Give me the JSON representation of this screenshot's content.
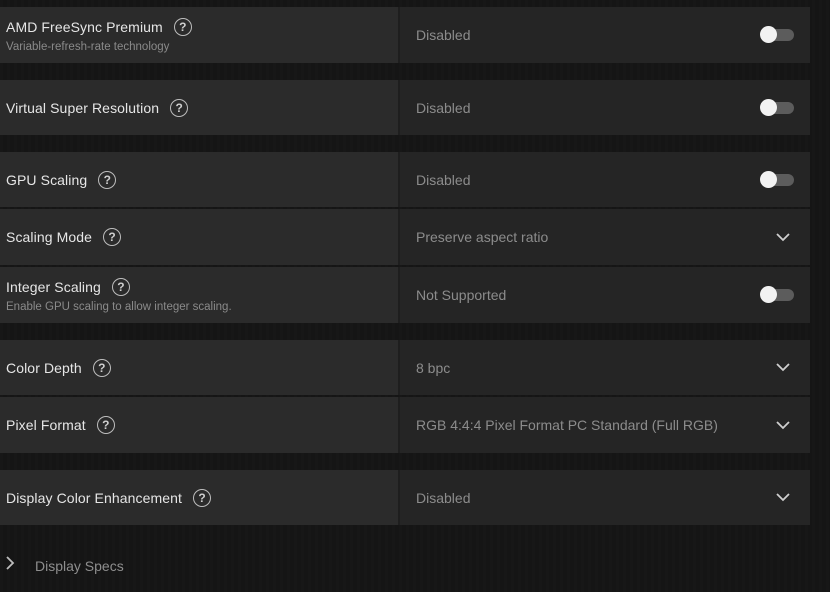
{
  "settings": [
    {
      "label": "AMD FreeSync Premium",
      "subtext": "Variable-refresh-rate technology",
      "value": "Disabled",
      "control": "toggle",
      "enabled": false
    },
    {
      "label": "Virtual Super Resolution",
      "subtext": "",
      "value": "Disabled",
      "control": "toggle",
      "enabled": false
    },
    {
      "label": "GPU Scaling",
      "subtext": "",
      "value": "Disabled",
      "control": "toggle",
      "enabled": false
    },
    {
      "label": "Scaling Mode",
      "subtext": "",
      "value": "Preserve aspect ratio",
      "control": "dropdown"
    },
    {
      "label": "Integer Scaling",
      "subtext": "Enable GPU scaling to allow integer scaling.",
      "value": "Not Supported",
      "control": "toggle",
      "enabled": false
    },
    {
      "label": "Color Depth",
      "subtext": "",
      "value": "8 bpc",
      "control": "dropdown"
    },
    {
      "label": "Pixel Format",
      "subtext": "",
      "value": "RGB 4:4:4 Pixel Format PC Standard (Full RGB)",
      "control": "dropdown"
    },
    {
      "label": "Display Color Enhancement",
      "subtext": "",
      "value": "Disabled",
      "control": "dropdown"
    }
  ],
  "footer": {
    "label": "Display Specs"
  },
  "icons": {
    "help": "help-circle-icon",
    "dropdown": "chevron-down-icon",
    "expand": "chevron-right-icon"
  },
  "colors": {
    "background": "#151515",
    "row_label_bg": "#2b2b2b",
    "row_value_bg": "#252525",
    "toggle_track": "#5c5c5c",
    "toggle_knob": "#f2f2f2"
  }
}
